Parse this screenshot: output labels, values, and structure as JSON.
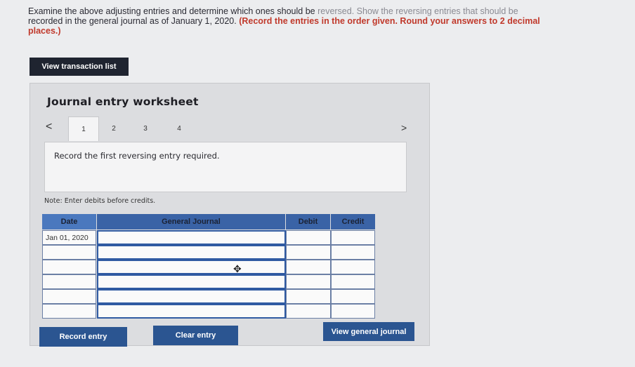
{
  "instructions": {
    "part1": "Examine the above adjusting entries and determine which ones should be ",
    "part2": "reversed. Show the reversing entries that should be",
    "part3": "recorded in the general journal as of January 1, 2020. ",
    "part4": "(Record the entries in the order given. Round your answers to 2 decimal",
    "part5": "places.)"
  },
  "view_transaction_list": "View transaction list",
  "worksheet": {
    "title": "Journal entry worksheet",
    "prev": "<",
    "next": ">",
    "tabs": [
      "1",
      "2",
      "3",
      "4"
    ],
    "prompt": "Record the first reversing entry required.",
    "note": "Note: Enter debits before credits."
  },
  "journal": {
    "headers": {
      "date": "Date",
      "account": "General Journal",
      "debit": "Debit",
      "credit": "Credit"
    },
    "rows": [
      {
        "date": "Jan 01, 2020",
        "account": "",
        "debit": "",
        "credit": ""
      },
      {
        "date": "",
        "account": "",
        "debit": "",
        "credit": ""
      },
      {
        "date": "",
        "account": "",
        "debit": "",
        "credit": ""
      },
      {
        "date": "",
        "account": "",
        "debit": "",
        "credit": ""
      },
      {
        "date": "",
        "account": "",
        "debit": "",
        "credit": ""
      },
      {
        "date": "",
        "account": "",
        "debit": "",
        "credit": ""
      }
    ]
  },
  "buttons": {
    "record_entry": "Record entry",
    "clear_entry": "Clear entry",
    "view_general_journal": "View general journal"
  },
  "colors": {
    "header_blue": "#3a63a6",
    "button_blue": "#2b5591",
    "dark_button": "#1f2430",
    "emphasis_red": "#c0392b"
  }
}
